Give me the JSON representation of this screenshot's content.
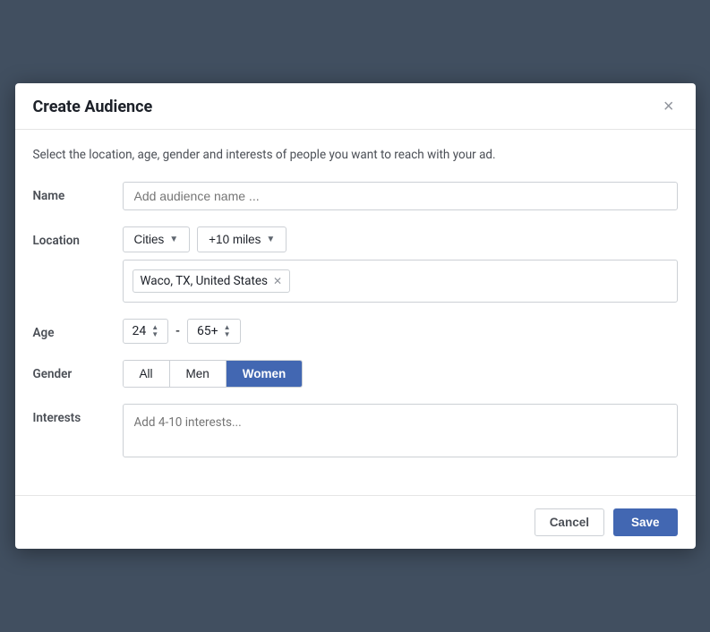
{
  "modal": {
    "title": "Create Audience",
    "subtitle": "Select the location, age, gender and interests of people you want to reach with your ad.",
    "close_label": "×"
  },
  "form": {
    "name": {
      "label": "Name",
      "placeholder": "Add audience name ..."
    },
    "location": {
      "label": "Location",
      "type_label": "Cities",
      "radius_label": "+10 miles",
      "tags": [
        {
          "text": "Waco, TX, United States"
        }
      ]
    },
    "age": {
      "label": "Age",
      "min": "24",
      "max": "65+",
      "separator": "-"
    },
    "gender": {
      "label": "Gender",
      "options": [
        {
          "label": "All",
          "active": false
        },
        {
          "label": "Men",
          "active": false
        },
        {
          "label": "Women",
          "active": true
        }
      ]
    },
    "interests": {
      "label": "Interests",
      "placeholder": "Add 4-10 interests..."
    }
  },
  "footer": {
    "cancel_label": "Cancel",
    "save_label": "Save"
  }
}
